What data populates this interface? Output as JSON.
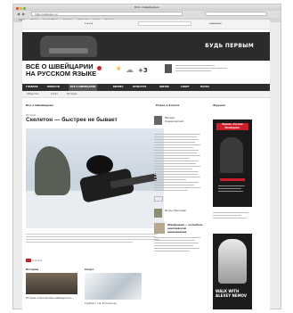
{
  "browser": {
    "window_title": "Всё о Швейцарии",
    "url": "http://allswiss.ru/",
    "bookmarks": [
      "Apple",
      "Yahoo!",
      "Google Maps",
      "YouTube",
      "Wikipedia",
      "News",
      "Popular"
    ]
  },
  "site": {
    "logo_line1": "ВСЁ О ШВЕЙЦАРИИ",
    "logo_line2": "НА РУССКОМ ЯЗЫКЕ",
    "weather": "+3",
    "banner_text": "БУДЬ ПЕРВЫМ",
    "nav": [
      "ГЛАВНАЯ",
      "НОВОСТИ",
      "ВСЁ О ШВЕЙЦАРИИ",
      "БИЗНЕС",
      "КУЛЬТУРА",
      "ЖИЗНЬ",
      "СПОРТ",
      "НАУКА"
    ],
    "subnav": [
      "Общество",
      "Спорт",
      "История"
    ],
    "sections": {
      "left": "Всё о Швейцарии",
      "middle": "Новое в блогах",
      "right": "Журнал"
    },
    "main_article": {
      "kicker": "История",
      "headline": "Скелетон — быстрее не бывает"
    },
    "bottom_sections": [
      "История",
      "Спорт"
    ],
    "bottom_captions": [
      "История и перспективы швейцарского...",
      "Глубина с гор. В погоне за..."
    ],
    "mid_posts": [
      "Михаил Ходорковский",
      "Игорь Николаев"
    ],
    "mid_blog_title": "Швейцария — колыбель европейской цивилизации",
    "ad_title": "Журнал «Русская Швейцария»",
    "ad2_text": "WALK WITH ALEXEY NEMOV"
  },
  "colors": {
    "nav_bg": "#2e2e2e",
    "accent_red": "#cc1f2a",
    "banner_bg": "#2b2b2d"
  }
}
